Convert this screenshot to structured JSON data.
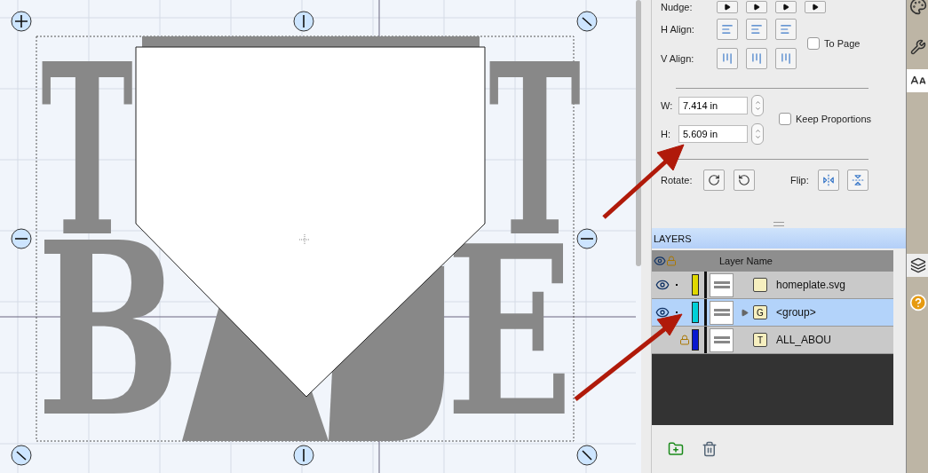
{
  "canvas": {
    "artwork": {
      "letters": [
        {
          "text": "T"
        },
        {
          "text": "T"
        },
        {
          "text": "B"
        },
        {
          "text": "E"
        }
      ]
    }
  },
  "transform_panel": {
    "nudge_label": "Nudge:",
    "h_align_label": "H Align:",
    "v_align_label": "V Align:",
    "to_page": {
      "label": "To Page",
      "checked": false
    },
    "width": {
      "label": "W:",
      "value": "7.414 in"
    },
    "height": {
      "label": "H:",
      "value": "5.609 in"
    },
    "keep_proportions": {
      "label": "Keep Proportions",
      "checked": false
    },
    "rotate_label": "Rotate:",
    "flip_label": "Flip:"
  },
  "layers": {
    "title": "LAYERS",
    "column": "Layer Name",
    "rows": [
      {
        "name": "homeplate.svg",
        "kind": "file",
        "visible": true,
        "locked": false,
        "color": "#e0d800",
        "selected": false,
        "expandable": false
      },
      {
        "name": "<group>",
        "kind": "group",
        "icon_letter": "G",
        "visible": true,
        "locked": false,
        "color": "#00d0d8",
        "selected": true,
        "expandable": true
      },
      {
        "name": "ALL_ABOU",
        "kind": "text",
        "icon_letter": "T",
        "visible": false,
        "locked": true,
        "color": "#0818d0",
        "selected": false,
        "expandable": false
      }
    ]
  }
}
